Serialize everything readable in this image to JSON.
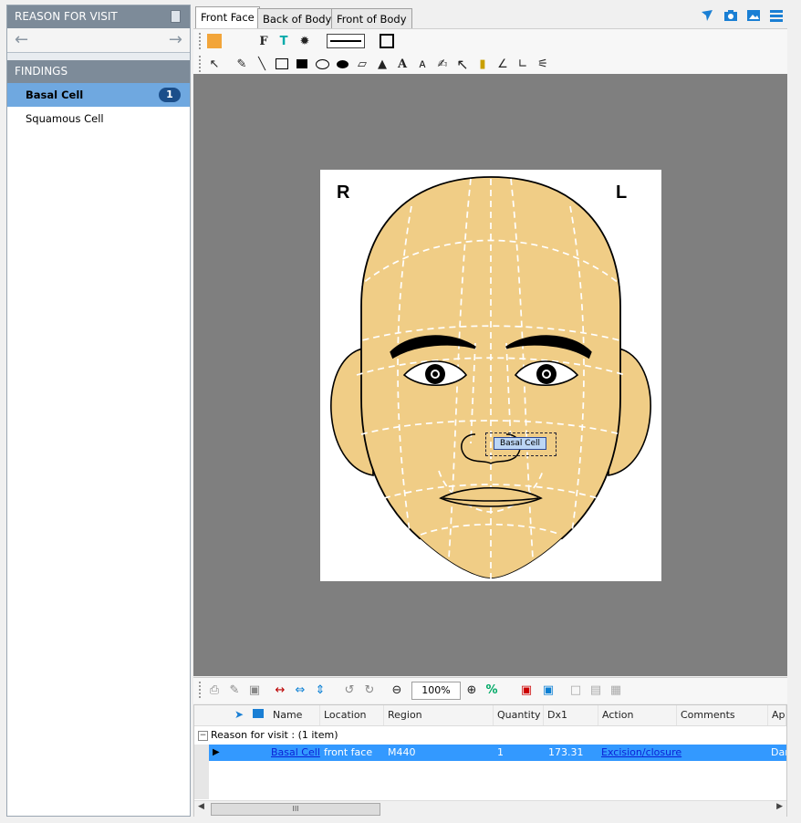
{
  "left_panel": {
    "header": "REASON FOR VISIT",
    "findings_header": "FINDINGS",
    "findings": [
      {
        "label": "Basal Cell",
        "count": "1",
        "selected": true
      },
      {
        "label": "Squamous Cell",
        "count": "",
        "selected": false
      }
    ]
  },
  "tabs": [
    "Front Face",
    "Back of Body",
    "Front of Body"
  ],
  "active_tab": "Front Face",
  "figure": {
    "left_label": "R",
    "right_label": "L",
    "annotation": "Basal Cell"
  },
  "bottom_toolbar": {
    "zoom_value": "100%",
    "percent_label": "%"
  },
  "grid": {
    "columns": [
      "Name",
      "Location",
      "Region",
      "Quantity",
      "Dx1",
      "Action",
      "Comments",
      "App"
    ],
    "group_label": "Reason for visit :  (1 item)",
    "rows": [
      {
        "name": "Basal Cell",
        "location": "front face",
        "region": "M440",
        "quantity": "1",
        "dx1": "173.31",
        "action": "Excision/closure",
        "comments": "",
        "app": "Dar"
      }
    ],
    "scroll_thumb": "III"
  },
  "icons": [
    "list-icon",
    "arrow-left-icon",
    "arrow-right-icon",
    "select-icon",
    "pencil-icon",
    "line-icon",
    "rectangle-icon",
    "ellipse-icon",
    "text-icon",
    "pointer-icon",
    "print-icon",
    "zoom-in-icon",
    "zoom-out-icon",
    "camera-icon",
    "image-icon",
    "menu-icon"
  ],
  "colors": {
    "accent": "#6fa8e0",
    "header_bg": "#7d8b99",
    "selection_row": "#3399ff",
    "canvas_bg": "#7f7f7f",
    "skin": "#f0cd86"
  }
}
